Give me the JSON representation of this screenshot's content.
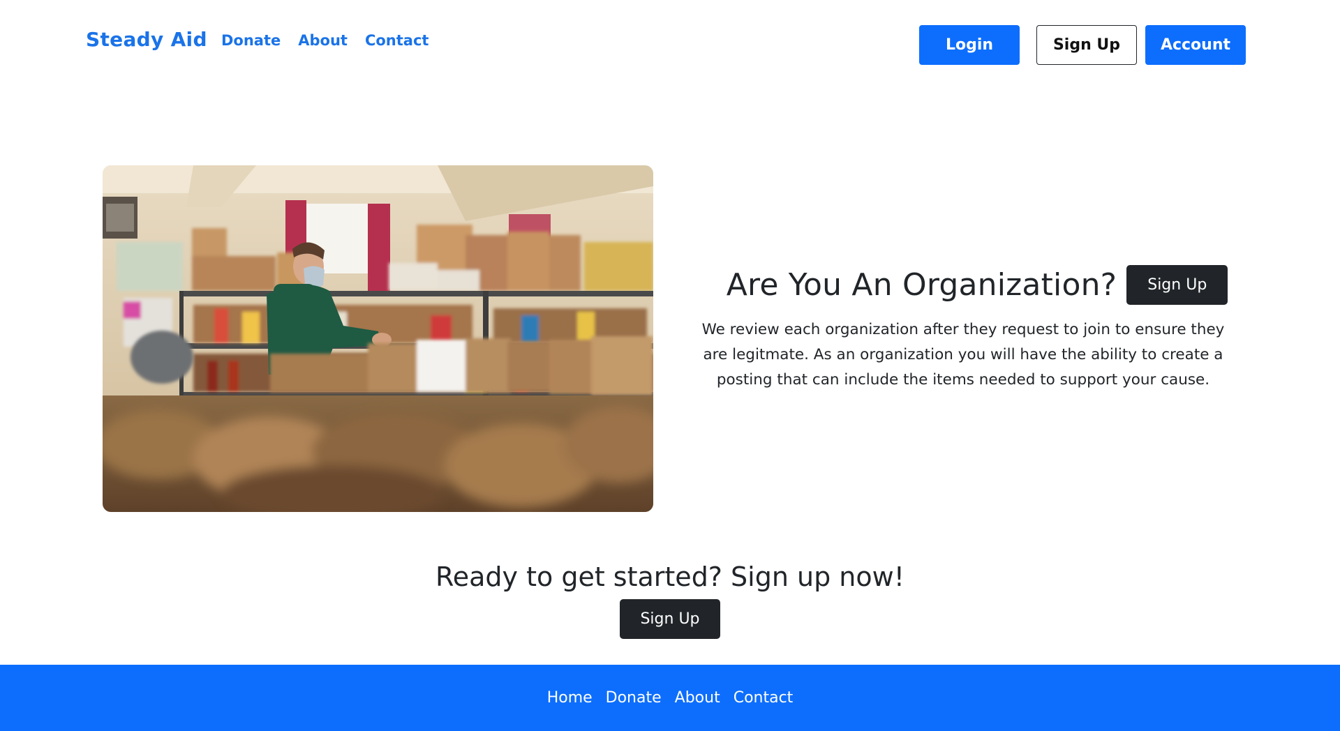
{
  "header": {
    "brand": "Steady Aid",
    "nav": [
      {
        "label": "Donate"
      },
      {
        "label": "About"
      },
      {
        "label": "Contact"
      }
    ],
    "login_label": "Login",
    "signup_label": "Sign Up",
    "account_label": "Account"
  },
  "hero": {
    "image_alt": "Volunteer in a face mask packing paper grocery bags in a food pantry",
    "title": "Are You An Organization?",
    "signup_label": "Sign Up",
    "description": "We review each organization after they request to join to ensure they are legitmate. As an organization you will have the ability to create a posting that can include the items needed to support your cause."
  },
  "cta": {
    "title": "Ready to get started? Sign up now!",
    "signup_label": "Sign Up"
  },
  "footer": {
    "links": [
      {
        "label": "Home"
      },
      {
        "label": "Donate"
      },
      {
        "label": "About"
      },
      {
        "label": "Contact"
      }
    ]
  },
  "colors": {
    "brand_blue": "#1a73e8",
    "primary": "#0d6efd",
    "dark": "#212529"
  }
}
